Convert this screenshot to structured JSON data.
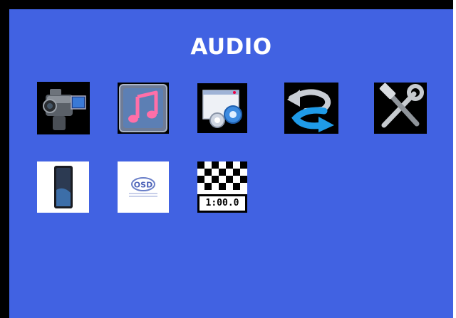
{
  "menu": {
    "title": "AUDIO",
    "selected": "audio",
    "items": [
      {
        "id": "camera",
        "icon": "camcorder-icon"
      },
      {
        "id": "audio",
        "icon": "music-note-icon"
      },
      {
        "id": "system",
        "icon": "gear-window-icon"
      },
      {
        "id": "playback",
        "icon": "return-arrow-icon"
      },
      {
        "id": "tools",
        "icon": "wrench-hammer-icon"
      },
      {
        "id": "storage",
        "icon": "sd-card-icon"
      },
      {
        "id": "osd",
        "icon": "osd-icon",
        "label": "OSD"
      },
      {
        "id": "lap-timer",
        "icon": "checkered-flag-icon",
        "label": "1:00.0"
      }
    ]
  },
  "colors": {
    "background": "#4162e2",
    "frame": "#000000",
    "title": "#ffffff"
  }
}
